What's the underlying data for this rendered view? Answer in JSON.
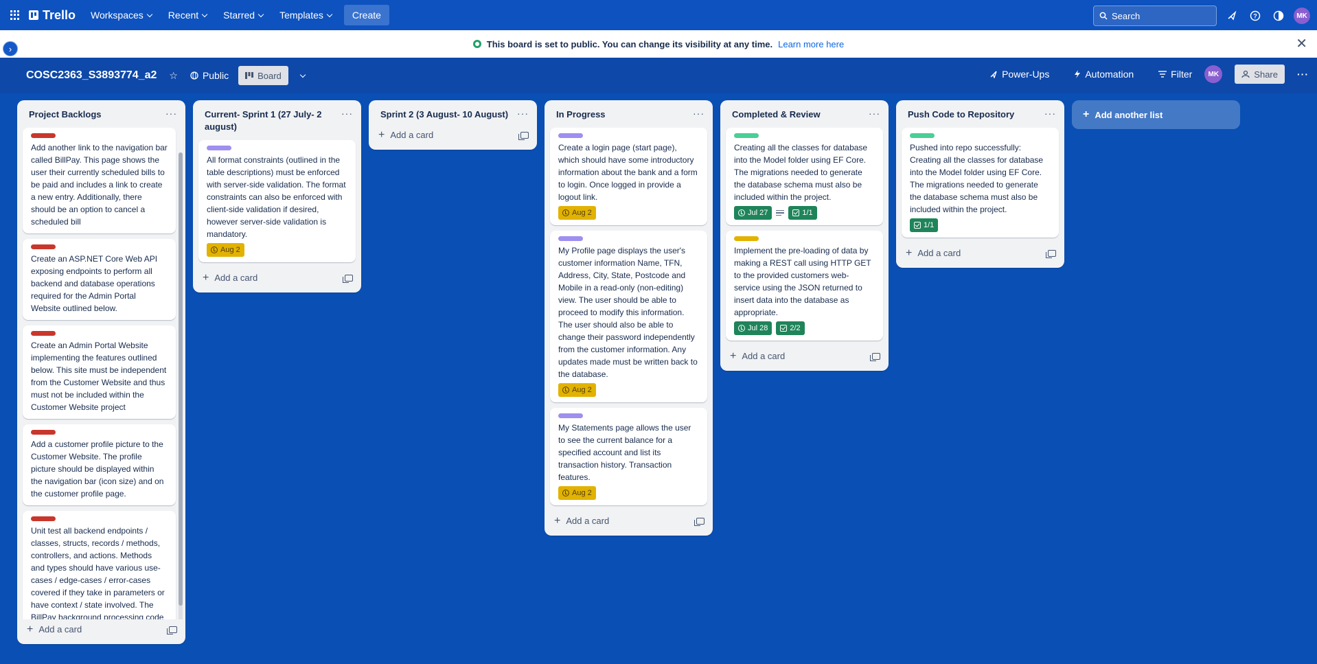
{
  "topnav": {
    "app_name": "Trello",
    "menus": [
      "Workspaces",
      "Recent",
      "Starred",
      "Templates"
    ],
    "create_label": "Create",
    "search_placeholder": "Search",
    "user_initials": "MK"
  },
  "notice": {
    "message": "This board is set to public. You can change its visibility at any time.",
    "link": "Learn more here"
  },
  "board": {
    "title": "COSC2363_S3893774_a2",
    "visibility": "Public",
    "view": "Board",
    "power_ups": "Power-Ups",
    "automation": "Automation",
    "filter": "Filter",
    "user_initials": "MK",
    "share": "Share"
  },
  "add_card_label": "Add a card",
  "add_list_label": "Add another list",
  "lists": [
    {
      "title": "Project Backlogs",
      "cards": [
        {
          "label": "red",
          "text": "Add another link to the navigation bar called BillPay. This page shows the user their currently scheduled bills to be paid and includes a link to create a new entry. Additionally, there should be an option to cancel a scheduled bill"
        },
        {
          "label": "red",
          "text": "Create an ASP.NET Core Web API exposing endpoints to perform all backend and database operations required for the Admin Portal Website outlined below."
        },
        {
          "label": "red",
          "text": "Create an Admin Portal Website implementing the features outlined below. This site must be independent from the Customer Website and thus must not be included within the Customer Website project"
        },
        {
          "label": "red",
          "text": "Add a customer profile picture to the Customer Website. The profile picture should be displayed within the navigation bar (icon size) and on the customer profile page."
        },
        {
          "label": "red",
          "text": "Unit test all backend endpoints / classes, structs, records / methods, controllers, and actions. Methods and types should have various use-cases / edge-cases / error-cases covered if they take in parameters or have context / state involved. The BillPay background processing code"
        }
      ]
    },
    {
      "title": "Current- Sprint 1 (27 July- 2 august)",
      "cards": [
        {
          "label": "purple",
          "text": "All format constraints (outlined in the table descriptions) must be enforced with server-side validation. The format constraints can also be enforced with client-side validation if desired, however server-side validation is mandatory.",
          "due": "Aug 2"
        }
      ]
    },
    {
      "title": "Sprint 2 (3 August- 10 August)",
      "cards": []
    },
    {
      "title": "In Progress",
      "cards": [
        {
          "label": "purple",
          "text": "Create a login page (start page), which should have some introductory information about the bank and a form to login. Once logged in provide a logout link.",
          "due": "Aug 2"
        },
        {
          "label": "purple",
          "text": "My Profile page displays the user's customer information Name, TFN, Address, City, State, Postcode and Mobile in a read-only (non-editing) view. The user should be able to proceed to modify this information. The user should also be able to change their password independently from the customer information. Any updates made must be written back to the database.",
          "due": "Aug 2"
        },
        {
          "label": "purple",
          "text": "My Statements page allows the user to see the current balance for a specified account and list its transaction history. Transaction features.",
          "due": "Aug 2"
        }
      ]
    },
    {
      "title": "Completed & Review",
      "cards": [
        {
          "label": "green",
          "text": "Creating all the classes for database into the Model folder using EF Core. The migrations needed to generate the database schema must also be included within the project.",
          "done": "Jul 27",
          "has_description": true,
          "checklist": "1/1"
        },
        {
          "label": "yellow",
          "text": "Implement the pre-loading of data by making a REST call using HTTP GET to the provided customers web-service using the JSON returned to insert data into the database as appropriate.",
          "done": "Jul 28",
          "checklist": "2/2"
        }
      ]
    },
    {
      "title": "Push Code to Repository",
      "cards": [
        {
          "label": "green",
          "text": "Pushed into repo successfully: Creating all the classes for database into the Model folder using EF Core. The migrations needed to generate the database schema must also be included within the project.",
          "checklist": "1/1"
        }
      ]
    }
  ]
}
